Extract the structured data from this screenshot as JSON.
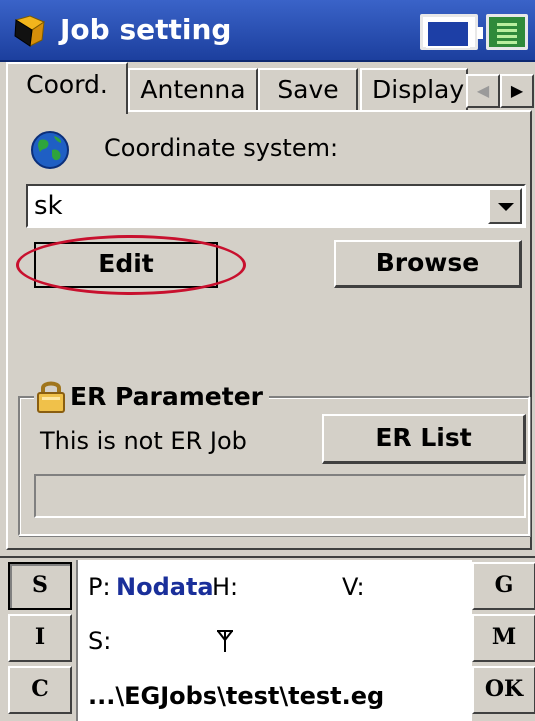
{
  "window": {
    "title": "Job setting"
  },
  "icons": {
    "app": "job-setting-icon",
    "battery": "battery-icon",
    "notes": "notes-icon",
    "globe": "globe-icon",
    "lock": "lock-icon",
    "antenna": "antenna-icon"
  },
  "tabs": [
    {
      "label": "Coord.",
      "active": true
    },
    {
      "label": "Antenna",
      "active": false
    },
    {
      "label": "Save",
      "active": false
    },
    {
      "label": "Display",
      "active": false
    }
  ],
  "tab_scroll": {
    "left": "◀",
    "right": "▶"
  },
  "coordinate": {
    "label": "Coordinate system:",
    "value": "sk",
    "edit_label": "Edit",
    "browse_label": "Browse"
  },
  "er": {
    "group_title": "ER Parameter",
    "status": "This is not ER Job",
    "list_label": "ER List",
    "field_value": ""
  },
  "status": {
    "left_buttons": [
      "S",
      "I",
      "C"
    ],
    "right_buttons": [
      "G",
      "M",
      "OK"
    ],
    "p_label": "P:",
    "p_value": "Nodata",
    "h_label": "H:",
    "v_label": "V:",
    "s_label": "S:",
    "path": "...\\EGJobs\\test\\test.eg"
  },
  "colors": {
    "titlebar": "#1c3f9e",
    "highlight": "#c8102e",
    "nodata": "#1a2f9a",
    "background": "#d4d0c8"
  }
}
